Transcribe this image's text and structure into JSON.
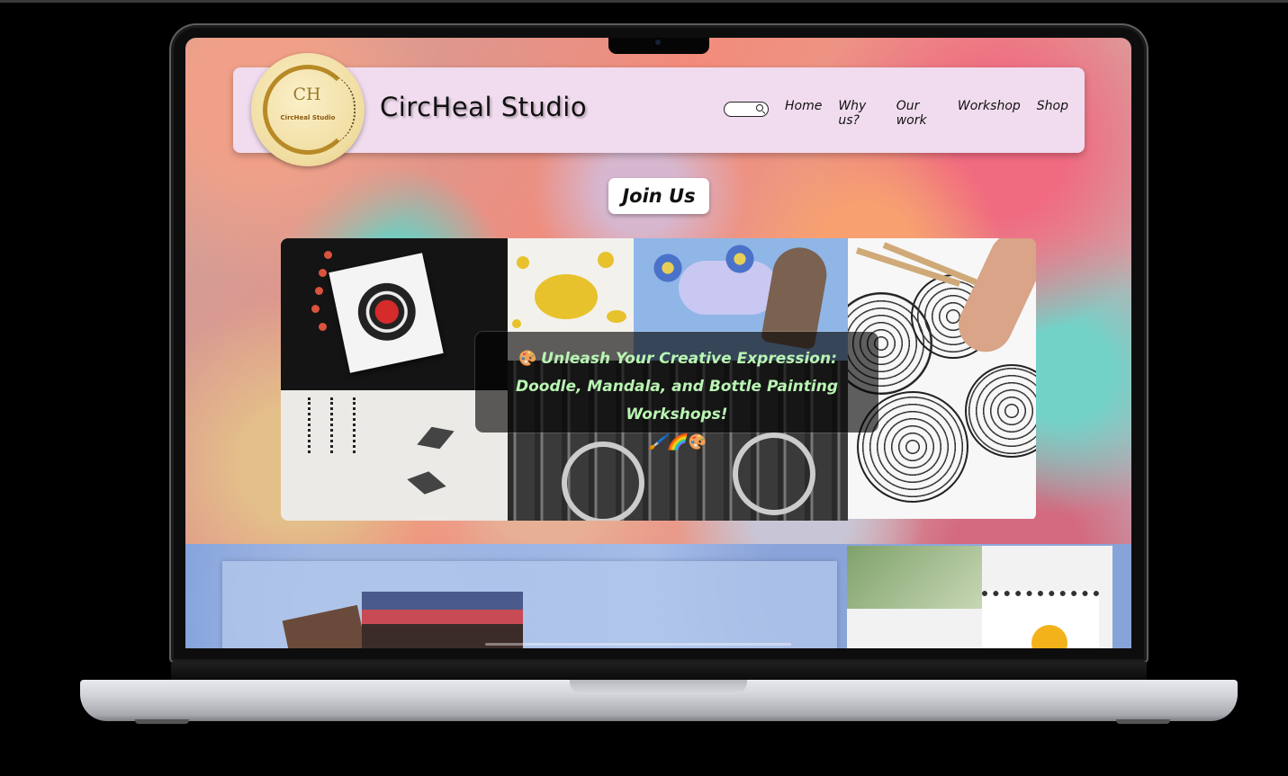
{
  "site": {
    "brand": "CircHeal Studio",
    "logo": {
      "monogram": "CH",
      "caption": "CircHeal Studio"
    }
  },
  "search": {
    "placeholder": ""
  },
  "nav": {
    "items": [
      "Home",
      "Why us?",
      "Our work",
      "Workshop",
      "Shop"
    ]
  },
  "hero": {
    "join_label": "Join Us",
    "overlay_line1": "🎨 Unleash Your Creative Expression:",
    "overlay_line2": "Doodle, Mandala, and Bottle Painting Workshops!",
    "overlay_line3": "🖌️🌈🎨"
  },
  "colors": {
    "header_bg": "#f1dcef",
    "overlay_text": "#b9f5b3",
    "logo_gold": "#b88a27"
  },
  "icons": [
    "search-icon"
  ]
}
